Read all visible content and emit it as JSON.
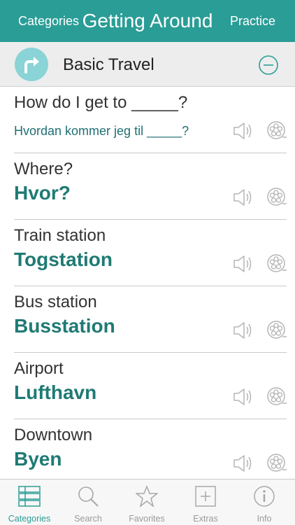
{
  "navbar": {
    "left_label": "Categories",
    "title": "Getting Around",
    "right_label": "Practice"
  },
  "section": {
    "title": "Basic Travel",
    "icon": "turn-right-arrow-icon",
    "collapse_icon": "minus-circle-icon"
  },
  "phrases": [
    {
      "english": "How do I get to _____?",
      "norwegian": "Hvordan kommer jeg til _____?"
    },
    {
      "english": "Where?",
      "norwegian": "Hvor?"
    },
    {
      "english": "Train station",
      "norwegian": "Togstation"
    },
    {
      "english": "Bus station",
      "norwegian": "Busstation"
    },
    {
      "english": "Airport",
      "norwegian": "Lufthavn"
    },
    {
      "english": "Downtown",
      "norwegian": "Byen"
    }
  ],
  "row_icons": [
    "speaker-icon",
    "film-reel-icon"
  ],
  "tabs": [
    {
      "label": "Categories",
      "icon": "list-icon",
      "active": true
    },
    {
      "label": "Search",
      "icon": "magnifier-icon",
      "active": false
    },
    {
      "label": "Favorites",
      "icon": "star-icon",
      "active": false
    },
    {
      "label": "Extras",
      "icon": "plus-square-icon",
      "active": false
    },
    {
      "label": "Info",
      "icon": "info-circle-icon",
      "active": false
    }
  ],
  "colors": {
    "accent": "#2a9d96",
    "phrase_text": "#1f7a74",
    "section_bg": "#ededed",
    "icon_gray": "#b5b5b5"
  }
}
